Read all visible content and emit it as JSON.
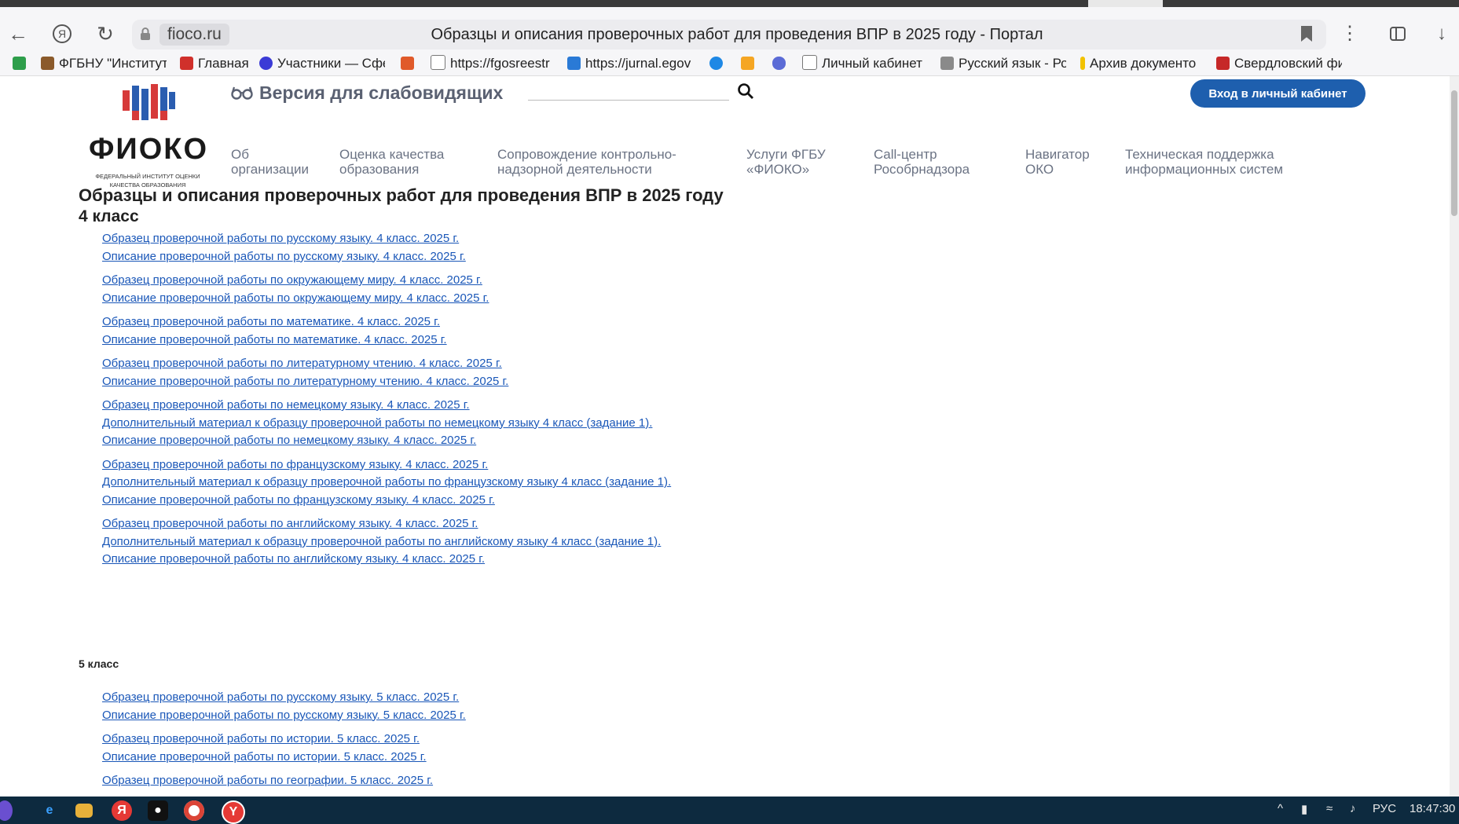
{
  "browser": {
    "back_icon": "arrow-left-icon",
    "yandex_icon": "yandex-logo-icon",
    "reload_icon": "reload-icon",
    "domain": "fioco.ru",
    "tab_title": "Образцы и описания проверочных работ для проведения ВПР в 2025 году - Портал",
    "bookmarks": [
      {
        "label": "ФГБНУ \"Институт",
        "color": "#8b5a2b"
      },
      {
        "label": "Главная",
        "color": "#d0302b"
      },
      {
        "label": "Участники — Сфе",
        "color": "#3b3bd6"
      },
      {
        "label": "",
        "color": "#e05a2a"
      },
      {
        "label": "https://fgosreestr",
        "color": "#777777"
      },
      {
        "label": "https://jurnal.egov",
        "color": "#2a7ad6"
      },
      {
        "label": "",
        "color": "#1e88e5"
      },
      {
        "label": "",
        "color": "#f5a623"
      },
      {
        "label": "",
        "color": "#5b6bd6"
      },
      {
        "label": "Личный кабинет",
        "color": "#777777"
      },
      {
        "label": "Русский язык - Ро",
        "color": "#8a8a8a"
      },
      {
        "label": "Архив документо",
        "color": "#f2c200"
      },
      {
        "label": "Свердловский фи",
        "color": "#c62828"
      }
    ]
  },
  "site": {
    "logo_text": "ФИОКО",
    "logo_sub": "Федеральный институт оценки качества образования",
    "visually_impaired": "Версия для слабовидящих",
    "search_placeholder": "",
    "login_label": "Вход в личный кабинет",
    "menu": [
      "Об\nорганизации",
      "Оценка качества\nобразования",
      "Сопровождение контрольно-\nнадзорной деятельности",
      "Услуги ФГБУ\n«ФИОКО»",
      "Call-центр\nРособрнадзора",
      "Навигатор\nОКО",
      "Техническая поддержка\nинформационных систем"
    ]
  },
  "content": {
    "title": "Образцы и описания проверочных работ для проведения ВПР в 2025 году",
    "grade4_heading": "4 класс",
    "grade4_groups": [
      [
        "Образец проверочной работы по русскому языку. 4 класс. 2025 г.",
        "Описание проверочной работы по русскому языку. 4 класс. 2025 г."
      ],
      [
        "Образец проверочной работы по окружающему миру. 4 класс. 2025 г.",
        "Описание проверочной работы по окружающему миру. 4 класс. 2025 г."
      ],
      [
        "Образец проверочной работы по математике. 4 класс. 2025 г.",
        "Описание проверочной работы по математике. 4 класс. 2025 г."
      ],
      [
        "Образец проверочной работы по литературному чтению. 4 класс. 2025 г.",
        "Описание проверочной работы по литературному чтению. 4 класс. 2025 г."
      ],
      [
        "Образец проверочной работы по немецкому языку. 4 класс. 2025 г.",
        "Дополнительный материал к образцу проверочной работы по немецкому языку 4 класс (задание 1).",
        "Описание проверочной работы по немецкому языку. 4 класс. 2025 г."
      ],
      [
        "Образец проверочной работы по французскому языку. 4 класс. 2025 г.",
        "Дополнительный материал к образцу проверочной работы по французскому языку 4 класс (задание 1).",
        "Описание проверочной работы по французскому языку. 4 класс. 2025 г."
      ],
      [
        "Образец проверочной работы по английскому языку. 4 класс. 2025 г.",
        "Дополнительный материал к образцу проверочной работы по английскому языку 4 класс (задание 1).",
        "Описание проверочной работы по английскому языку. 4 класс. 2025 г."
      ]
    ],
    "grade5_heading": "5 класс",
    "grade5_groups": [
      [
        "Образец проверочной работы по русскому языку. 5 класс. 2025 г.",
        "Описание проверочной работы по русскому языку. 5 класс. 2025 г."
      ],
      [
        "Образец проверочной работы по истории. 5 класс. 2025 г.",
        "Описание проверочной работы по истории. 5 класс. 2025 г."
      ],
      [
        "Образец проверочной работы по географии. 5 класс. 2025 г."
      ]
    ]
  },
  "taskbar": {
    "lang": "РУС",
    "time": "18:47:30",
    "tray_arrow": "^"
  },
  "colors": {
    "link": "#1a57b8",
    "accent_button": "#1e5fae",
    "taskbar": "#0d2a3f"
  }
}
